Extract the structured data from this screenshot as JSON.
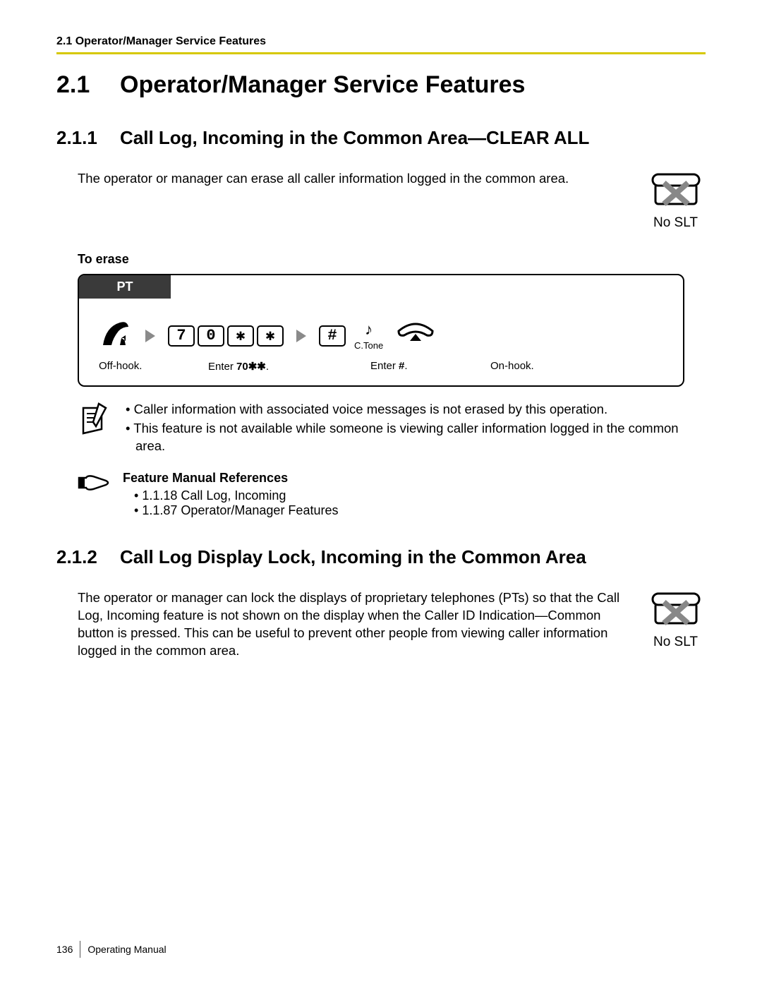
{
  "header": {
    "label": "2.1 Operator/Manager Service Features"
  },
  "section": {
    "number": "2.1",
    "title": "Operator/Manager Service Features"
  },
  "sub1": {
    "number": "2.1.1",
    "title": "Call Log, Incoming in the Common Area—CLEAR ALL",
    "intro": "The operator or manager can erase all caller information logged in the common area.",
    "no_slt": "No SLT",
    "to_erase": "To erase",
    "pt_tab": "PT",
    "keys": [
      "7",
      "0",
      "✱",
      "✱"
    ],
    "hash_key": "#",
    "ctone": "C.Tone",
    "captions": {
      "off_hook": "Off-hook.",
      "enter_prefix": "Enter ",
      "enter_code": "70✱✱",
      "enter_suffix": ".",
      "enter_hash_prefix": "Enter ",
      "enter_hash": "#",
      "enter_hash_suffix": ".",
      "on_hook": "On-hook."
    },
    "notes": [
      "Caller information with associated voice messages is not erased by this operation.",
      "This feature is not available while someone is viewing caller information logged in the common area."
    ],
    "ref_title": "Feature Manual References",
    "refs": [
      "1.1.18 Call Log, Incoming",
      "1.1.87 Operator/Manager Features"
    ]
  },
  "sub2": {
    "number": "2.1.2",
    "title": "Call Log Display Lock, Incoming in the Common Area",
    "intro": "The operator or manager can lock the displays of proprietary telephones (PTs) so that the Call Log, Incoming feature is not shown on the display when the Caller ID Indication—Common button is pressed. This can be useful to prevent other people from viewing caller information logged in the common area.",
    "no_slt": "No SLT"
  },
  "footer": {
    "page": "136",
    "manual": "Operating Manual"
  }
}
